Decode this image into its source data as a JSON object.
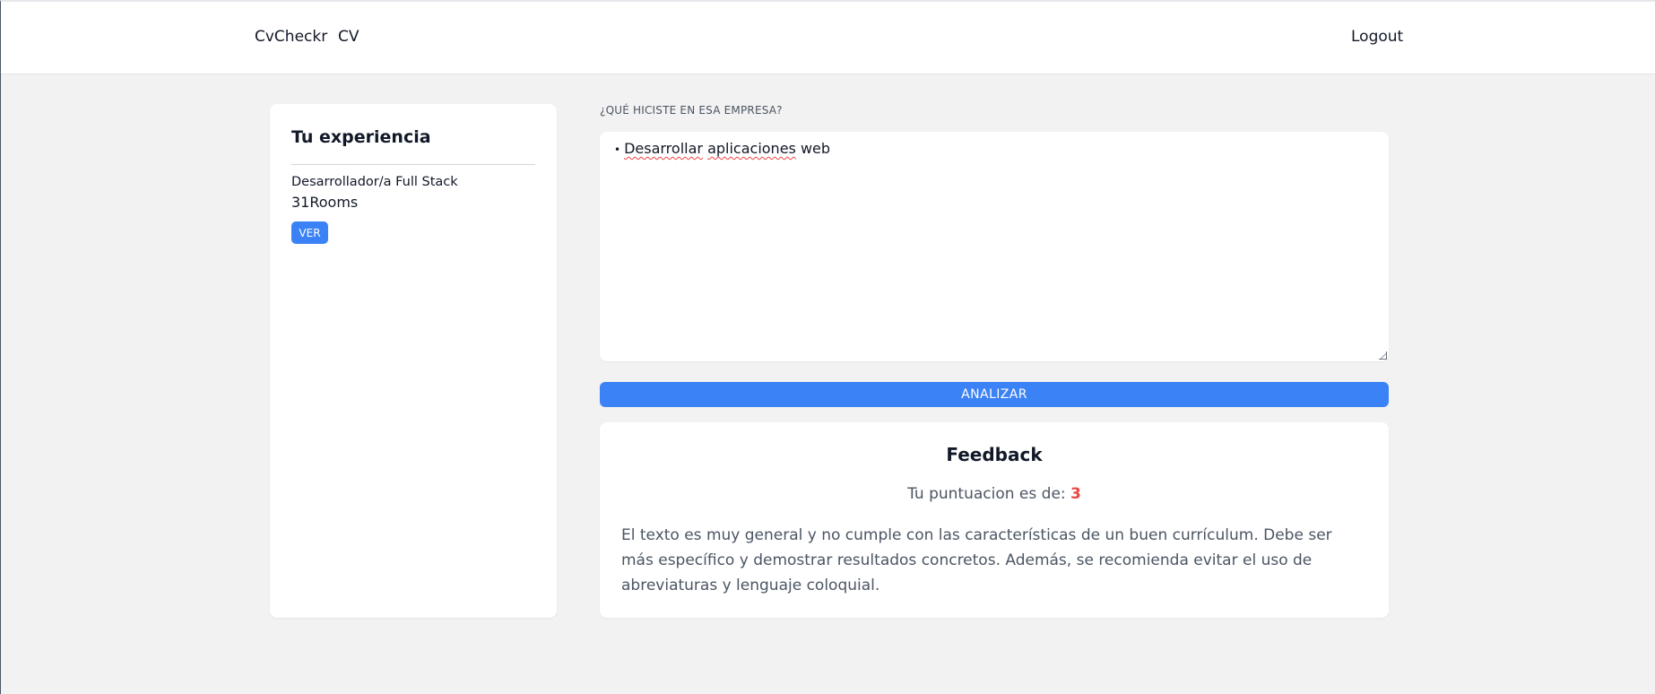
{
  "nav": {
    "brand": "CvCheckr",
    "cv_link": "CV",
    "logout": "Logout"
  },
  "experience": {
    "title": "Tu experiencia",
    "items": [
      {
        "role": "Desarrollador/a Full Stack",
        "company": "31Rooms",
        "button": "VER"
      }
    ]
  },
  "form": {
    "label": "¿QUÉ HICISTE EN ESA EMPRESA?",
    "bullet": "•",
    "text_part1": "Desarrollar",
    "text_part2": "aplicaciones",
    "text_part3": "web",
    "analyze_button": "ANALIZAR"
  },
  "feedback": {
    "title": "Feedback",
    "score_label": "Tu puntuacion es de:",
    "score_value": "3",
    "text": "El texto es muy general y no cumple con las características de un buen currículum. Debe ser más específico y demostrar resultados concretos. Además, se recomienda evitar el uso de abreviaturas y lenguaje coloquial."
  },
  "colors": {
    "primary": "#3b82f6",
    "score": "#ef4444",
    "background": "#f2f2f2"
  }
}
